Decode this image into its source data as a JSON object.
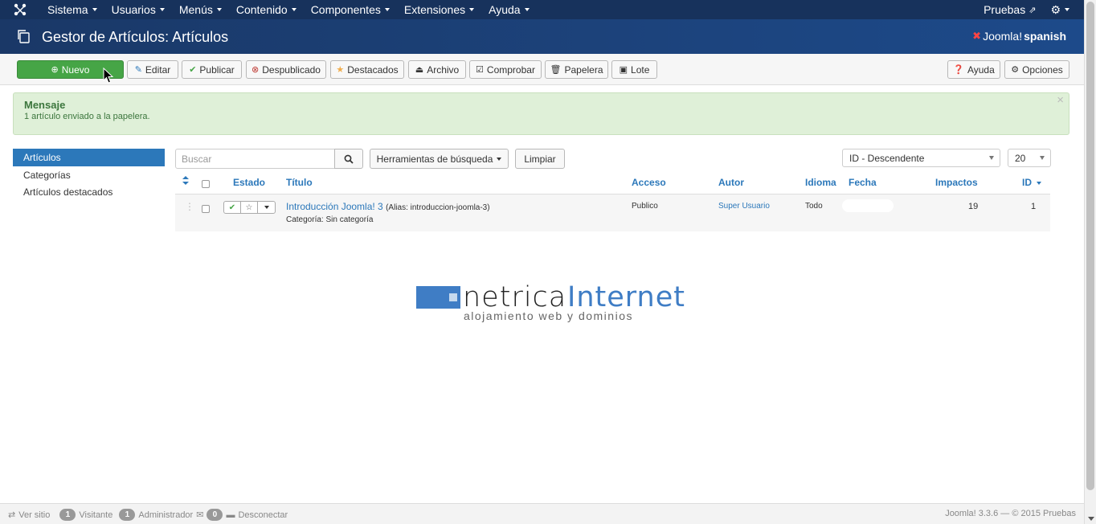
{
  "navbar": {
    "menus": [
      "Sistema",
      "Usuarios",
      "Menús",
      "Contenido",
      "Componentes",
      "Extensiones",
      "Ayuda"
    ],
    "site_name": "Pruebas"
  },
  "header": {
    "title": "Gestor de Artículos: Artículos",
    "brand_joomla": "Joomla!",
    "brand_spanish": "spanish"
  },
  "toolbar": {
    "new": "Nuevo",
    "edit": "Editar",
    "publish": "Publicar",
    "unpublish": "Despublicado",
    "featured": "Destacados",
    "archive": "Archivo",
    "check": "Comprobar",
    "trash": "Papelera",
    "batch": "Lote",
    "help": "Ayuda",
    "options": "Opciones"
  },
  "message": {
    "heading": "Mensaje",
    "text": "1 artículo enviado a la papelera.",
    "close": "×"
  },
  "sidebar": {
    "items": [
      "Artículos",
      "Categorías",
      "Artículos destacados"
    ]
  },
  "filters": {
    "search_placeholder": "Buscar",
    "search_tools": "Herramientas de búsqueda",
    "clear": "Limpiar",
    "order": "ID - Descendente",
    "limit": "20"
  },
  "table": {
    "headers": {
      "estado": "Estado",
      "titulo": "Título",
      "acceso": "Acceso",
      "autor": "Autor",
      "idioma": "Idioma",
      "fecha": "Fecha",
      "impactos": "Impactos",
      "id": "ID"
    },
    "rows": [
      {
        "title": "Introducción Joomla! 3",
        "alias": "(Alias: introduccion-joomla-3)",
        "category": "Categoría: Sin categoría",
        "access": "Publico",
        "author": "Super Usuario",
        "language": "Todo",
        "hits": "19",
        "id": "1"
      }
    ]
  },
  "logo": {
    "word1": "netrica",
    "word2": "Internet",
    "tagline": "alojamiento web y dominios"
  },
  "footer": {
    "view_site": "Ver sitio",
    "visitors_count": "1",
    "visitors_label": "Visitante",
    "admins_count": "1",
    "admins_label": "Administrador",
    "messages_count": "0",
    "logout": "Desconectar",
    "copyright": "Joomla! 3.3.6 — © 2015 Pruebas"
  },
  "colors": {
    "navbar": "#17325c",
    "header": "#1d4a8a",
    "new_button": "#46a546",
    "link": "#2c78ba",
    "alert_bg": "#dff0d8",
    "alert_text": "#3c763d"
  }
}
